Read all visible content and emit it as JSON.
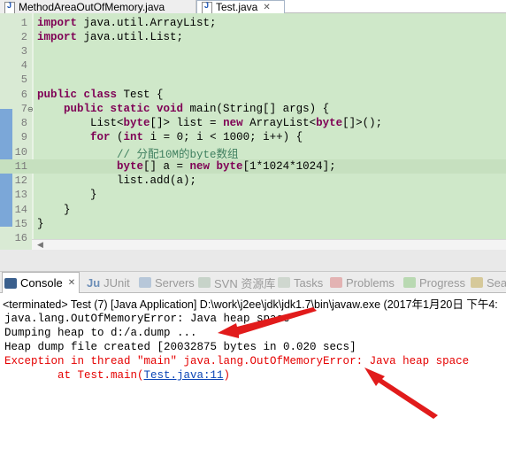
{
  "editor_tabs": [
    {
      "label": "MethodAreaOutOfMemory.java",
      "active": false
    },
    {
      "label": "Test.java",
      "active": true,
      "close": "✕"
    }
  ],
  "code": {
    "line_numbers": [
      "1",
      "2",
      "3",
      "4",
      "5",
      "6",
      "7",
      "8",
      "9",
      "10",
      "11",
      "12",
      "13",
      "14",
      "15",
      "16"
    ],
    "lines": [
      "import java.util.ArrayList;",
      "import java.util.List;",
      "",
      "",
      "",
      "public class Test {",
      "    public static void main(String[] args) {",
      "        List<byte[]> list = new ArrayList<byte[]>();",
      "        for (int i = 0; i < 1000; i++) {",
      "            // 分配10M的byte数组",
      "            byte[] a = new byte[1*1024*1024];",
      "            list.add(a);",
      "        }",
      "    }",
      "}",
      ""
    ]
  },
  "views": {
    "tabs": [
      {
        "label": "Console",
        "icon": "console-icon",
        "active": true,
        "close": "✕"
      },
      {
        "label": "JUnit",
        "prefix": "Ju",
        "icon": "junit-icon"
      },
      {
        "label": "Servers",
        "icon": "servers-icon"
      },
      {
        "label": "SVN 资源库",
        "icon": "svn-icon"
      },
      {
        "label": "Tasks",
        "icon": "tasks-icon"
      },
      {
        "label": "Problems",
        "icon": "problems-icon"
      },
      {
        "label": "Progress",
        "icon": "progress-icon"
      },
      {
        "label": "Sear",
        "icon": "search-icon"
      }
    ]
  },
  "console": {
    "terminated": "<terminated> Test (7) [Java Application] D:\\work\\j2ee\\jdk\\jdk1.7\\bin\\javaw.exe (2017年1月20日 下午4:",
    "lines": [
      "java.lang.OutOfMemoryError: Java heap space",
      "Dumping heap to d:/a.dump ...",
      "Heap dump file created [20032875 bytes in 0.020 secs]",
      "Exception in thread \"main\" java.lang.OutOfMemoryError: Java heap space"
    ],
    "stack_prefix": "        at Test.main(",
    "stack_link": "Test.java:11",
    "stack_suffix": ")"
  },
  "colors": {
    "editor_bg": "#cfe8c9",
    "keyword": "#7f0055",
    "comment": "#3f7f5f",
    "error_text": "#e50000",
    "annotation_arrow": "#e11b1b"
  }
}
